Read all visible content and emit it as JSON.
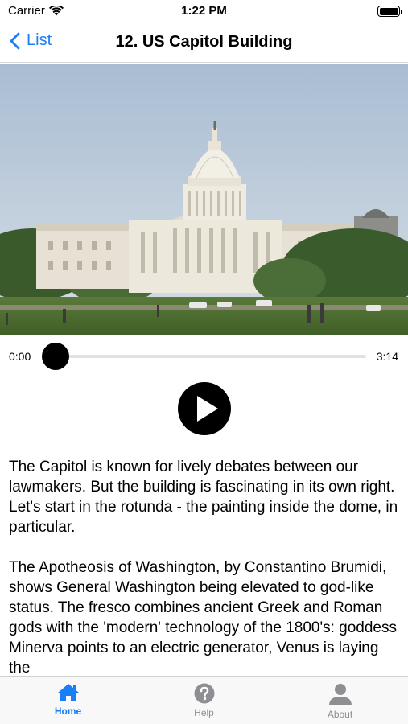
{
  "status_bar": {
    "carrier": "Carrier",
    "time": "1:22 PM"
  },
  "nav": {
    "back_label": "List",
    "title": "12. US Capitol Building"
  },
  "player": {
    "current_time": "0:00",
    "duration": "3:14",
    "progress": 0
  },
  "description": {
    "paragraphs": [
      "The Capitol is known for lively debates between our lawmakers. But the building is fascinating in its own right. Let's start in the rotunda - the painting inside the dome, in particular.",
      "The Apotheosis of Washington, by Constantino Brumidi, shows General Washington being elevated to god-like status. The fresco combines ancient Greek and Roman gods with the 'modern' technology of the 1800's: goddess Minerva points to an electric generator, Venus is laying the"
    ]
  },
  "tabs": [
    {
      "label": "Home",
      "icon": "house-icon",
      "active": true
    },
    {
      "label": "Help",
      "icon": "question-circle-icon",
      "active": false
    },
    {
      "label": "About",
      "icon": "person-icon",
      "active": false
    }
  ],
  "colors": {
    "accent": "#1a7ef7",
    "inactive_tab": "#8e8e93"
  }
}
